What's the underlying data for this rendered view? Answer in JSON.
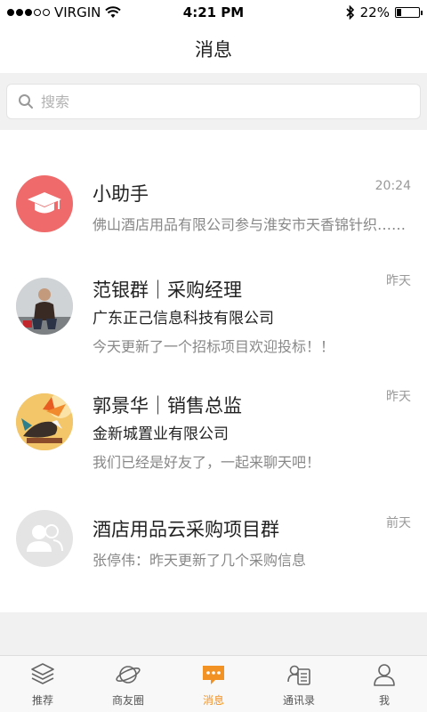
{
  "status_bar": {
    "carrier": "VIRGIN",
    "time": "4:21 PM",
    "battery": "22%",
    "battery_level": 0.22
  },
  "header": {
    "title": "消息"
  },
  "search": {
    "placeholder": "搜索"
  },
  "messages": [
    {
      "title": "小助手",
      "company": "",
      "preview": "佛山酒店用品有限公司参与淮安市天香锦针织……",
      "time": "20:24",
      "avatar": "graduation-cap-icon"
    },
    {
      "title": "范银群｜采购经理",
      "company": "广东正己信息科技有限公司",
      "preview": "今天更新了一个招标项目欢迎投标！！",
      "time": "昨天",
      "avatar": "photo-man"
    },
    {
      "title": "郭景华｜销售总监",
      "company": "金新城置业有限公司",
      "preview": "我们已经是好友了，一起来聊天吧！",
      "time": "昨天",
      "avatar": "photo-bird-flower"
    },
    {
      "title": "酒店用品云采购项目群",
      "company": "",
      "preview": "张停伟：昨天更新了几个采购信息",
      "time": "前天",
      "avatar": "group-icon"
    }
  ],
  "tabs": [
    {
      "label": "推荐",
      "icon": "layers-icon"
    },
    {
      "label": "商友圈",
      "icon": "planet-icon"
    },
    {
      "label": "消息",
      "icon": "chat-bubble-icon"
    },
    {
      "label": "通讯录",
      "icon": "contacts-icon"
    },
    {
      "label": "我",
      "icon": "person-icon"
    }
  ],
  "colors": {
    "accent": "#f39224",
    "assistant_avatar": "#ef6a6a",
    "group_avatar": "#e4e4e4"
  }
}
